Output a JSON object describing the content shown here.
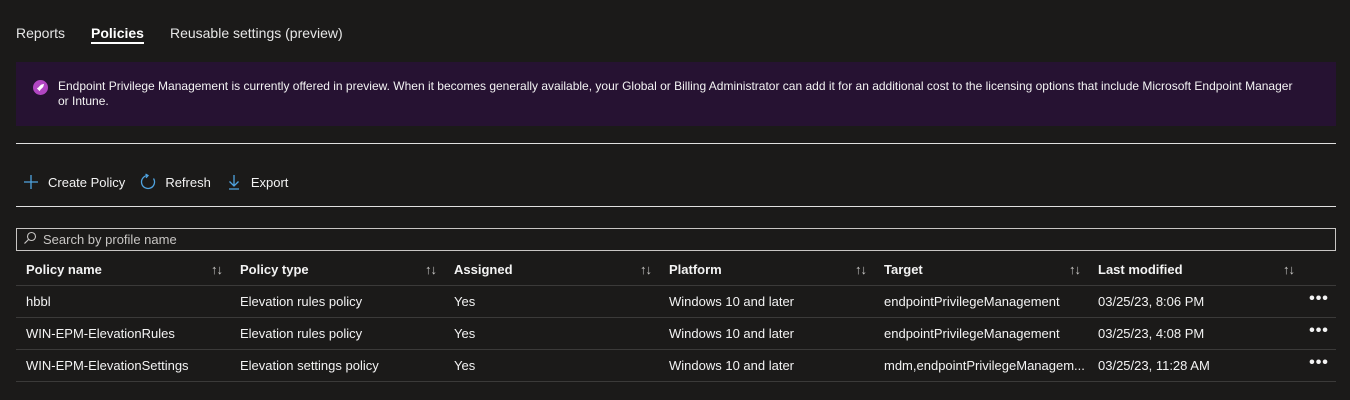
{
  "tabs": [
    {
      "label": "Reports"
    },
    {
      "label": "Policies"
    },
    {
      "label": "Reusable settings (preview)"
    }
  ],
  "banner": {
    "icon": "rocket-icon",
    "text": "Endpoint Privilege Management is currently offered in preview. When it becomes generally available, your Global or Billing Administrator can add it for an additional cost to the licensing options that include Microsoft Endpoint Manager or Intune.",
    "background": "#261232",
    "icon_color": "#b146c2"
  },
  "toolbar": {
    "create_label": "Create Policy",
    "refresh_label": "Refresh",
    "export_label": "Export"
  },
  "search": {
    "placeholder": "Search by profile name",
    "value": ""
  },
  "table": {
    "columns": [
      "Policy name",
      "Policy type",
      "Assigned",
      "Platform",
      "Target",
      "Last modified"
    ],
    "sort_glyph": "↑↓",
    "more_glyph": "•••",
    "rows": [
      {
        "name": "hbbl",
        "type": "Elevation rules policy",
        "assigned": "Yes",
        "platform": "Windows 10 and later",
        "target": "endpointPrivilegeManagement",
        "modified": "03/25/23, 8:06 PM"
      },
      {
        "name": "WIN-EPM-ElevationRules",
        "type": "Elevation rules policy",
        "assigned": "Yes",
        "platform": "Windows 10 and later",
        "target": "endpointPrivilegeManagement",
        "modified": "03/25/23, 4:08 PM"
      },
      {
        "name": "WIN-EPM-ElevationSettings",
        "type": "Elevation settings policy",
        "assigned": "Yes",
        "platform": "Windows 10 and later",
        "target": "mdm,endpointPrivilegeManagem...",
        "modified": "03/25/23, 11:28 AM"
      }
    ]
  },
  "colors": {
    "background": "#1b1a19",
    "accent": "#4fa3e0"
  }
}
